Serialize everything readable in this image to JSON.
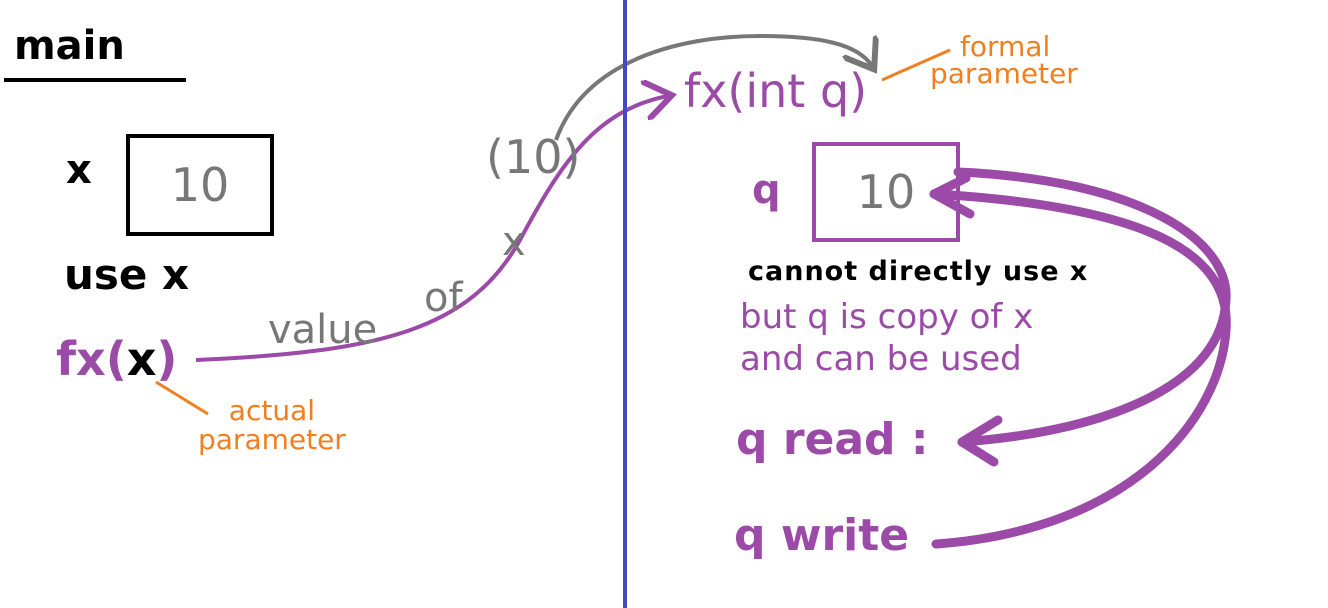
{
  "main": {
    "title": "main",
    "x_label": "x",
    "x_value": "10",
    "use_line": "use x",
    "call_fn": "fx",
    "call_open": "(",
    "call_arg": "x",
    "call_close": ")",
    "actual_param_line1": "actual",
    "actual_param_line2": "parameter"
  },
  "transfer": {
    "arg_value": "(10)",
    "word_value": "value",
    "word_of": "of",
    "word_x": "x"
  },
  "function": {
    "signature": "fx(int q)",
    "formal_param_line1": "formal",
    "formal_param_line2": "parameter",
    "q_label": "q",
    "q_value": "10",
    "cannot_text": "cannot directly use x",
    "copy_line1": "but q is copy of x",
    "copy_line2": "and can be used",
    "read_line": "q read :",
    "write_line": "q write"
  },
  "colors": {
    "purple": "#9b4aa8",
    "gray": "#777777",
    "orange": "#f07f20",
    "divider_blue": "#4448c8",
    "black": "#000000"
  }
}
